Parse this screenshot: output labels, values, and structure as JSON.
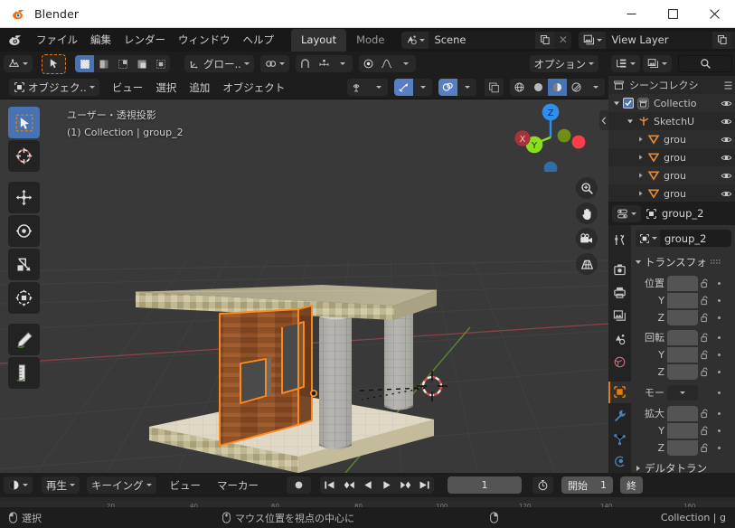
{
  "window": {
    "title": "Blender",
    "minimize_label": "—",
    "maximize_label": "□",
    "close_label": "✕"
  },
  "topbar": {
    "menus": [
      "ファイル",
      "編集",
      "レンダー",
      "ウィンドウ",
      "ヘルプ"
    ],
    "workspace_tabs": [
      {
        "label": "Layout",
        "active": true
      },
      {
        "label": "Mode",
        "active": false
      }
    ],
    "scene": {
      "name": "Scene",
      "copy_label": "",
      "close_label": "✕"
    },
    "view_layer": {
      "name": "View Layer",
      "copy_label": "",
      "close_label": "✕"
    }
  },
  "viewport": {
    "header_tools": {
      "editor_type": "editor-type-3dview",
      "transform_orientation": "グロー..",
      "options_label": "オプション"
    },
    "mode": "オブジェク..",
    "menus": [
      "ビュー",
      "選択",
      "追加",
      "オブジェクト"
    ],
    "overlay_line1": "ユーザー・透視投影",
    "overlay_line2": "(1) Collection | group_2",
    "gizmo_axes": [
      "X",
      "Y",
      "Z"
    ],
    "gizmo_colors": {
      "x": "#fc3d4a",
      "y": "#8ade21",
      "z": "#2e8fee"
    },
    "tools": [
      "tweak-select-box-tool",
      "cursor-tool",
      "move-tool",
      "rotate-tool",
      "scale-tool",
      "transform-tool",
      "annotate-tool",
      "measure-tool"
    ],
    "nav_buttons": [
      "zoom-icon",
      "pan-hand-icon",
      "camera-icon",
      "perspective-grid-icon"
    ]
  },
  "outliner": {
    "display_mode": "outliner-display-mode",
    "filter": "filter-icon",
    "search_placeholder": "",
    "rows": [
      {
        "label": "シーンコレクシ",
        "indent": 0,
        "icon": "scene-collection-icon",
        "eye": false
      },
      {
        "label": "Collectio",
        "indent": 1,
        "icon": "collection-icon",
        "eye": true
      },
      {
        "label": "SketchU",
        "indent": 2,
        "icon": "empty-axes-icon",
        "eye": true
      },
      {
        "label": "grou",
        "indent": 3,
        "icon": "mesh-data-icon",
        "eye": true
      },
      {
        "label": "grou",
        "indent": 3,
        "icon": "mesh-data-icon",
        "eye": true
      },
      {
        "label": "grou",
        "indent": 3,
        "icon": "mesh-data-icon",
        "eye": true
      },
      {
        "label": "grou",
        "indent": 3,
        "icon": "mesh-data-icon",
        "eye": true
      }
    ]
  },
  "properties": {
    "breadcrumb": "group_2",
    "object_name": "group_2",
    "panel_title": "トランスフォ",
    "tabs": [
      "tool-icon",
      "render-icon",
      "output-icon",
      "view-layer-icon",
      "scene-icon",
      "world-icon",
      "object-icon",
      "modifier-wrench-icon",
      "particles-icon",
      "physics-icon"
    ],
    "active_tab": "object-icon",
    "accent_color": "#e87d0d",
    "transform": {
      "location": {
        "label": "位置",
        "axes": [
          "Y",
          "Z"
        ]
      },
      "rotation": {
        "label": "回転",
        "axes": [
          "Y",
          "Z"
        ]
      },
      "mode": {
        "label": "モー"
      },
      "scale": {
        "label": "拡大",
        "axes": [
          "Y",
          "Z"
        ]
      },
      "delta_label": "デルタトラン"
    }
  },
  "timeline": {
    "menus": [
      "再生",
      "キーイング",
      "ビュー",
      "マーカー"
    ],
    "current_frame": "1",
    "start_label": "開始",
    "start_value": "1",
    "end_label": "終",
    "transport": [
      "jump-to-start-icon",
      "jump-prev-keyframe-icon",
      "play-reverse-icon",
      "play-icon",
      "jump-next-keyframe-icon",
      "jump-to-end-icon"
    ],
    "record_icon": "record-icon"
  },
  "statusbar": {
    "left_action": "選択",
    "middle_action": "マウス位置を視点の中心に",
    "right_text": "Collection | g"
  },
  "scene3d": {
    "selected_object_outline": "#ff8b1f",
    "objects": [
      "wood-wall",
      "stone-column-left",
      "stone-column-right",
      "floor-slab",
      "roof-beam"
    ]
  }
}
